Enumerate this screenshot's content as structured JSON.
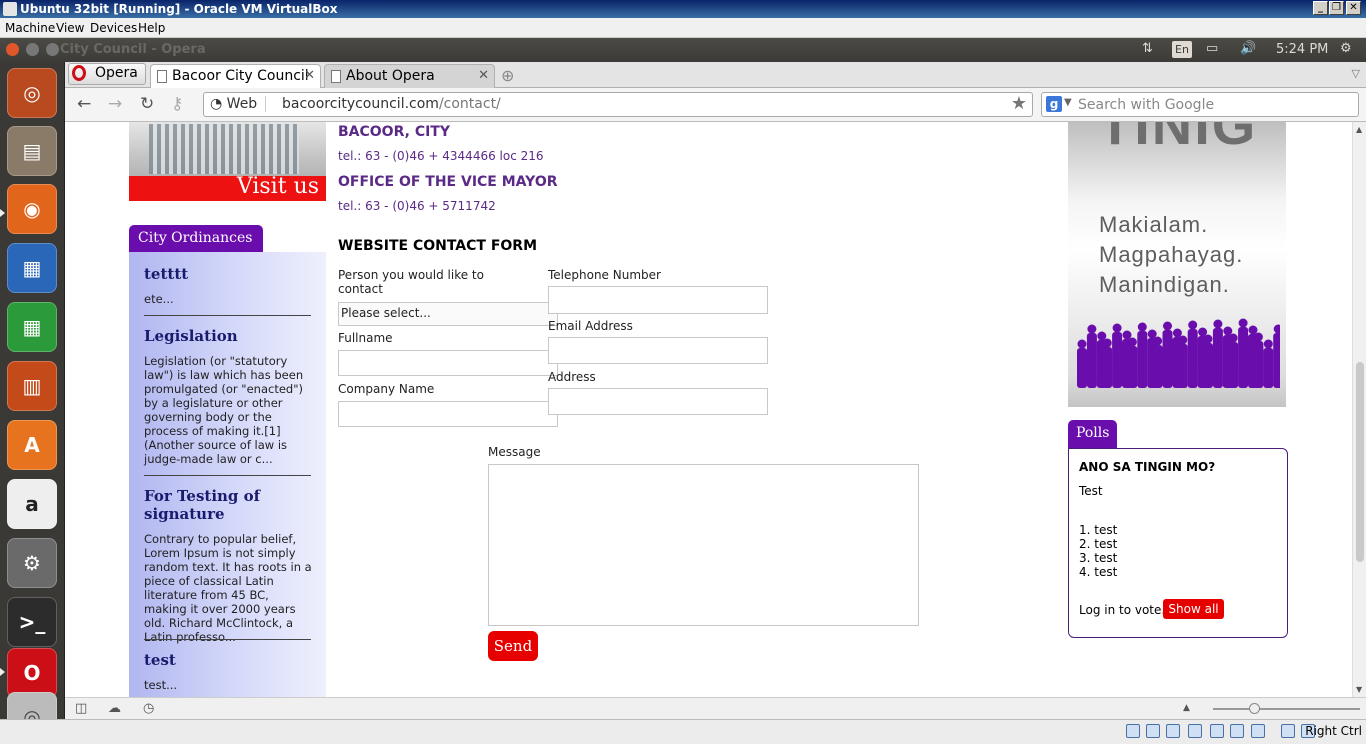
{
  "vbox": {
    "title": "Ubuntu 32bit [Running] - Oracle VM VirtualBox",
    "menu": [
      "Machine",
      "View",
      "Devices",
      "Help"
    ],
    "host_key": "Right Ctrl"
  },
  "ubuntu_panel": {
    "window_title": "City Council - Opera",
    "lang": "En",
    "clock": "5:24 PM"
  },
  "launcher": {
    "apps": [
      "ubuntu-dash",
      "files",
      "firefox",
      "writer",
      "calc",
      "impress",
      "software-center",
      "amazon",
      "system-settings",
      "terminal",
      "opera",
      "dvd"
    ]
  },
  "browser": {
    "menu_label": "Opera",
    "tabs": [
      {
        "label": "Bacoor City Council",
        "active": true
      },
      {
        "label": "About Opera",
        "active": false
      }
    ],
    "address_prefix": "Web",
    "url_host": "bacoorcitycouncil.com",
    "url_path": "/contact/",
    "search_placeholder": "Search with Google"
  },
  "page": {
    "visit_banner": "Visit us",
    "contacts": [
      {
        "office": "BACOOR, CITY",
        "tel": "tel.: 63 - (0)46 + 4344466 loc 216"
      },
      {
        "office": "OFFICE OF THE VICE MAYOR",
        "tel": "tel.: 63 - (0)46 + 5711742"
      }
    ],
    "ordinances": {
      "heading": "City Ordinances",
      "items": [
        {
          "title": "tetttt",
          "excerpt": "ete..."
        },
        {
          "title": "Legislation",
          "excerpt": "Legislation (or \"statutory law\") is law which has been promulgated (or \"enacted\") by a legislature or other governing body or the process of making it.[1] (Another source of law is judge-made law or c..."
        },
        {
          "title": "For Testing of signature",
          "excerpt": "Contrary to popular belief, Lorem Ipsum is not simply random text. It has roots in a piece of classical Latin literature from 45 BC, making it over 2000 years old. Richard McClintock, a Latin professo..."
        },
        {
          "title": "test",
          "excerpt": "test..."
        }
      ]
    },
    "form": {
      "title": "WEBSITE CONTACT FORM",
      "person_label": "Person you would like to contact",
      "person_value": "Please select...",
      "fullname_label": "Fullname",
      "company_label": "Company Name",
      "phone_label": "Telephone Number",
      "email_label": "Email Address",
      "address_label": "Address",
      "message_label": "Message",
      "send_label": "Send"
    },
    "banner": {
      "big_text": "TINIG",
      "lines": [
        "Makialam.",
        "Magpahayag.",
        "Manindigan."
      ],
      "accent": "#6a0dad"
    },
    "polls": {
      "heading": "Polls",
      "question": "ANO SA TINGIN MO?",
      "description": "Test",
      "options": [
        "1. test",
        "2. test",
        "3. test",
        "4. test"
      ],
      "login_text": "Log in to vote.",
      "show_all": "Show all"
    }
  }
}
